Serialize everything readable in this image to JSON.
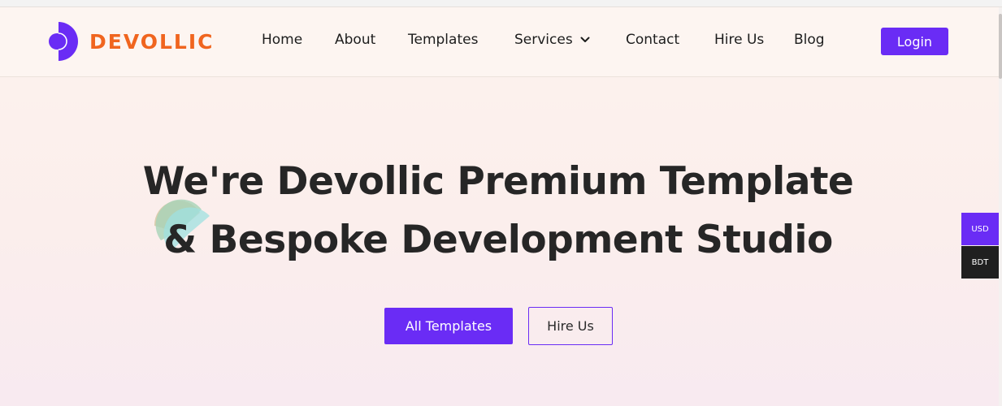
{
  "brand": {
    "name": "DEVOLLIC",
    "logo_icon": "half-circle-logo-icon",
    "accent_color": "#6a2cf5",
    "brand_color": "#f0651f"
  },
  "nav": {
    "home": "Home",
    "about": "About",
    "templates": "Templates",
    "services": "Services",
    "contact": "Contact",
    "hire_us": "Hire Us",
    "blog": "Blog",
    "services_icon": "chevron-down-icon"
  },
  "header": {
    "login_label": "Login"
  },
  "hero": {
    "title_line1": "We're Devollic Premium Template",
    "title_line2": "& Bespoke Development Studio",
    "primary_button": "All Templates",
    "secondary_button": "Hire Us"
  },
  "currency": {
    "usd": "USD",
    "bdt": "BDT"
  }
}
